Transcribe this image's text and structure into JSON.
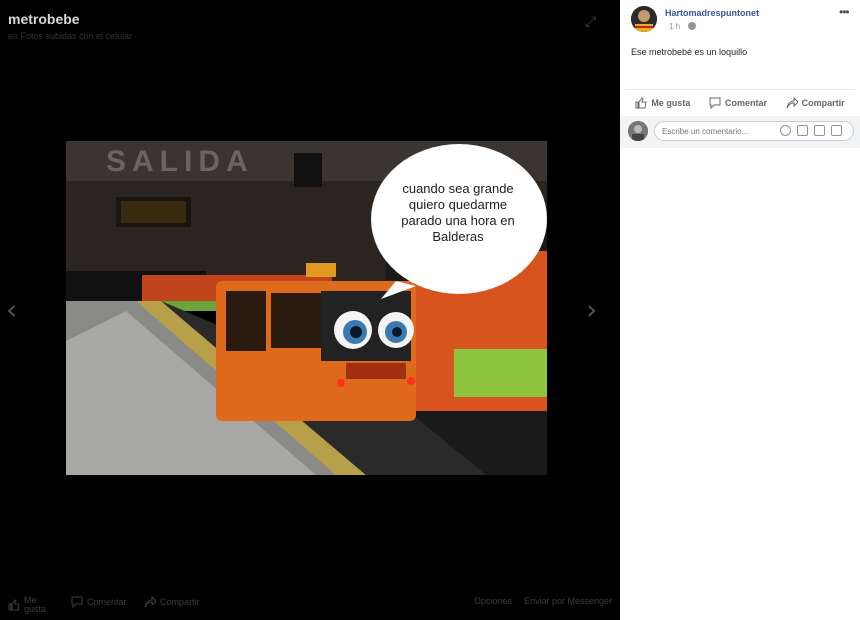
{
  "viewer": {
    "album_title": "metrobebe",
    "album_subtitle": "en Fotos subidas con el celular",
    "photo_caption_bubble": "cuando sea grande quiero quedarme parado una hora en Balderas",
    "footer": {
      "like_label": "Me gusta",
      "comment_label": "Comentar",
      "share_label": "Compartir",
      "options_label": "Opciones",
      "messenger_label": "Enviar por Messenger"
    }
  },
  "post": {
    "page_name": "Hartomadrespuntonet",
    "timestamp": "1 h",
    "caption": "Ese metrobebé es un loquillo",
    "actions": {
      "like": "Me gusta",
      "comment": "Comentar",
      "share": "Compartir"
    },
    "comment_placeholder": "Escribe un comentario..."
  }
}
